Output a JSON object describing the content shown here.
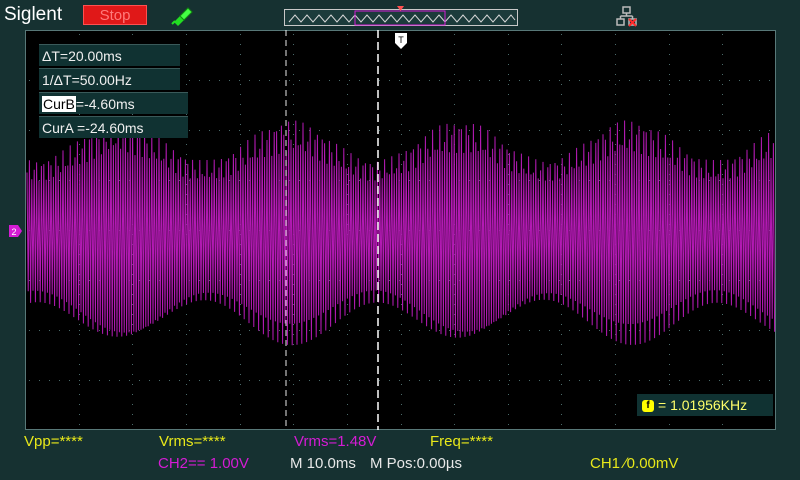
{
  "header": {
    "brand": "Siglent",
    "run_state": "Stop"
  },
  "cursors": {
    "delta_t": "ΔT=20.00ms",
    "inv_delta_t": "1/ΔT=50.00Hz",
    "cur_b_label": "CurB",
    "cur_b_value": "=-4.60ms",
    "cur_a": "CurA =-24.60ms"
  },
  "frequency_readout": "= 1.01956KHz",
  "measurements": {
    "vpp": "Vpp=****",
    "vrms_ch1": "Vrms=****",
    "vrms_ch2": "Vrms=1.48V",
    "freq": "Freq=****"
  },
  "status": {
    "ch2": "CH2== 1.00V",
    "timebase": "M 10.0ms",
    "mpos": "M Pos:0.00µs",
    "trigger": "CH1 ∕0.00mV"
  },
  "colors": {
    "trace": "#b41ab4",
    "ch1_yellow": "#e8e81a",
    "ch2_magenta": "#d41cd4",
    "stop_red": "#e01818"
  },
  "icons": {
    "trigger": "pencil-probe-icon",
    "network": "network-icon"
  }
}
